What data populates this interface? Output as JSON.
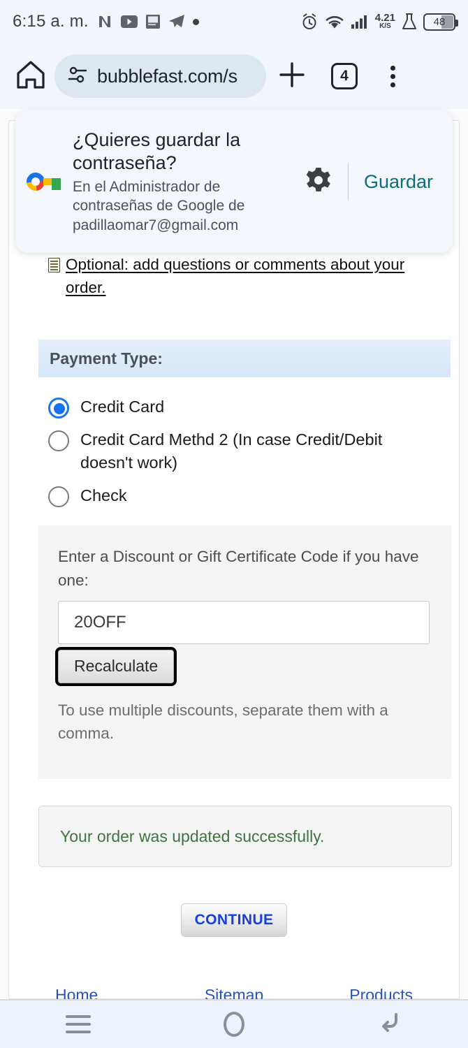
{
  "status_bar": {
    "time": "6:15 a. m.",
    "notification_icons": [
      "nfc-icon",
      "youtube-icon",
      "bible-app-icon",
      "telegram-icon",
      "dot-icon"
    ],
    "alarm_icon": "alarm-icon",
    "wifi_icon": "wifi-icon",
    "signal_icon": "cellular-signal-icon",
    "network_speed_value": "4.21",
    "network_speed_unit": "K/S",
    "lab_icon": "flask-icon",
    "battery_level": "48"
  },
  "browser": {
    "home_icon": "home-icon",
    "site_settings_icon": "tune-icon",
    "url": "bubblefast.com/s",
    "new_tab_icon": "plus-icon",
    "tab_count": "4",
    "menu_icon": "three-dot-menu-icon"
  },
  "password_dialog": {
    "key_icon": "google-password-key-icon",
    "title": "¿Quieres guardar la contraseña?",
    "subtitle": "En el Administrador de contraseñas de Google de padillaomar7@gmail.com",
    "gear_icon": "gear-icon",
    "save_label": "Guardar",
    "accent_color": "#0d6d7c"
  },
  "page": {
    "optional_note_icon": "notepad-icon",
    "optional_note_link": "Optional: add questions or comments about your order.",
    "payment_section_title": "Payment Type:",
    "payment_options": [
      {
        "label": "Credit Card",
        "selected": true
      },
      {
        "label": "Credit Card Methd 2 (In case Credit/Debit doesn't work)",
        "selected": false
      },
      {
        "label": "Check",
        "selected": false
      }
    ],
    "discount": {
      "label": "Enter a Discount or Gift Certificate Code if you have one:",
      "input_value": "20OFF",
      "input_placeholder": "",
      "recalculate_label": "Recalculate",
      "hint": "To use multiple discounts, separate them with a comma."
    },
    "status_message": "Your order was updated successfully.",
    "status_color": "#3f7340",
    "continue_label": "CONTINUE",
    "footer_links": [
      "Home",
      "Sitemap",
      "Products"
    ]
  },
  "navigation_bar": {
    "recents_icon": "hamburger-recents-icon",
    "home_icon": "home-circle-icon",
    "back_icon": "back-arrow-icon"
  }
}
